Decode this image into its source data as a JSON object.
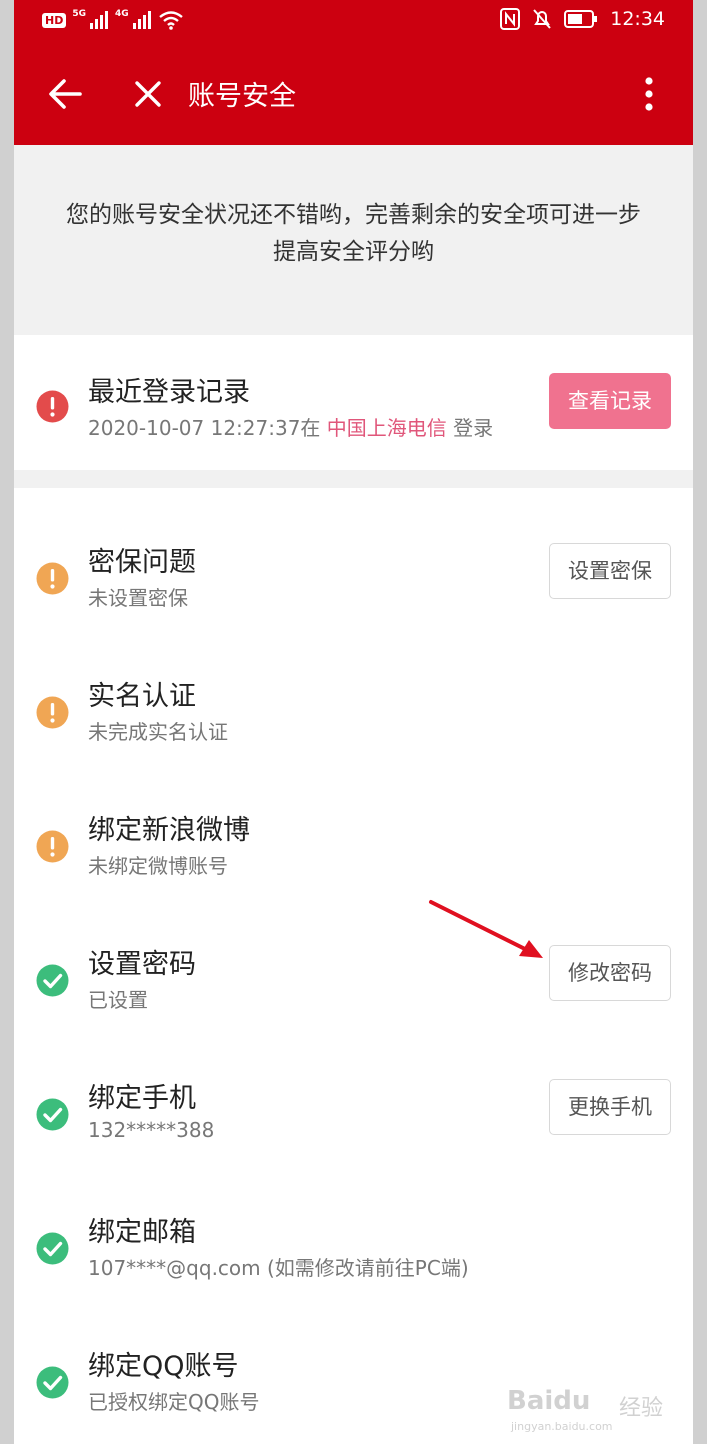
{
  "colors": {
    "appbar": "#cc0010",
    "danger": "#e34b4b",
    "warning": "#f0a654",
    "success": "#3cbd7c",
    "primary_button": "#f0728f",
    "location_text": "#e0567a"
  },
  "status_bar": {
    "network_badge": "HD",
    "signal1": "5G",
    "signal2": "4G",
    "time": "12:34"
  },
  "toolbar": {
    "back_icon": "arrow-left-icon",
    "close_icon": "close-icon",
    "title": "账号安全",
    "more_icon": "more-vertical-icon"
  },
  "intro_text": "您的账号安全状况还不错哟，完善剩余的安全项可进一步提高安全评分哟",
  "recent_login": {
    "icon": "error-icon",
    "title": "最近登录记录",
    "time": "2020-10-07 12:27:37在",
    "location": "中国上海电信",
    "suffix": "登录",
    "button": "查看记录"
  },
  "items": [
    {
      "icon": "warning-icon",
      "title": "密保问题",
      "subtitle": "未设置密保",
      "button": "设置密保"
    },
    {
      "icon": "warning-icon",
      "title": "实名认证",
      "subtitle": "未完成实名认证",
      "button": ""
    },
    {
      "icon": "warning-icon",
      "title": "绑定新浪微博",
      "subtitle": "未绑定微博账号",
      "button": ""
    },
    {
      "icon": "check-icon",
      "title": "设置密码",
      "subtitle": "已设置",
      "button": "修改密码"
    },
    {
      "icon": "check-icon",
      "title": "绑定手机",
      "subtitle": "132*****388",
      "button": "更换手机"
    },
    {
      "icon": "check-icon",
      "title": "绑定邮箱",
      "subtitle": "107****@qq.com (如需修改请前往PC端)",
      "button": ""
    },
    {
      "icon": "check-icon",
      "title": "绑定QQ账号",
      "subtitle": "已授权绑定QQ账号",
      "button": ""
    }
  ],
  "watermark": {
    "brand": "Baidu",
    "brand_cn": "经验",
    "url": "jingyan.baidu.com"
  }
}
